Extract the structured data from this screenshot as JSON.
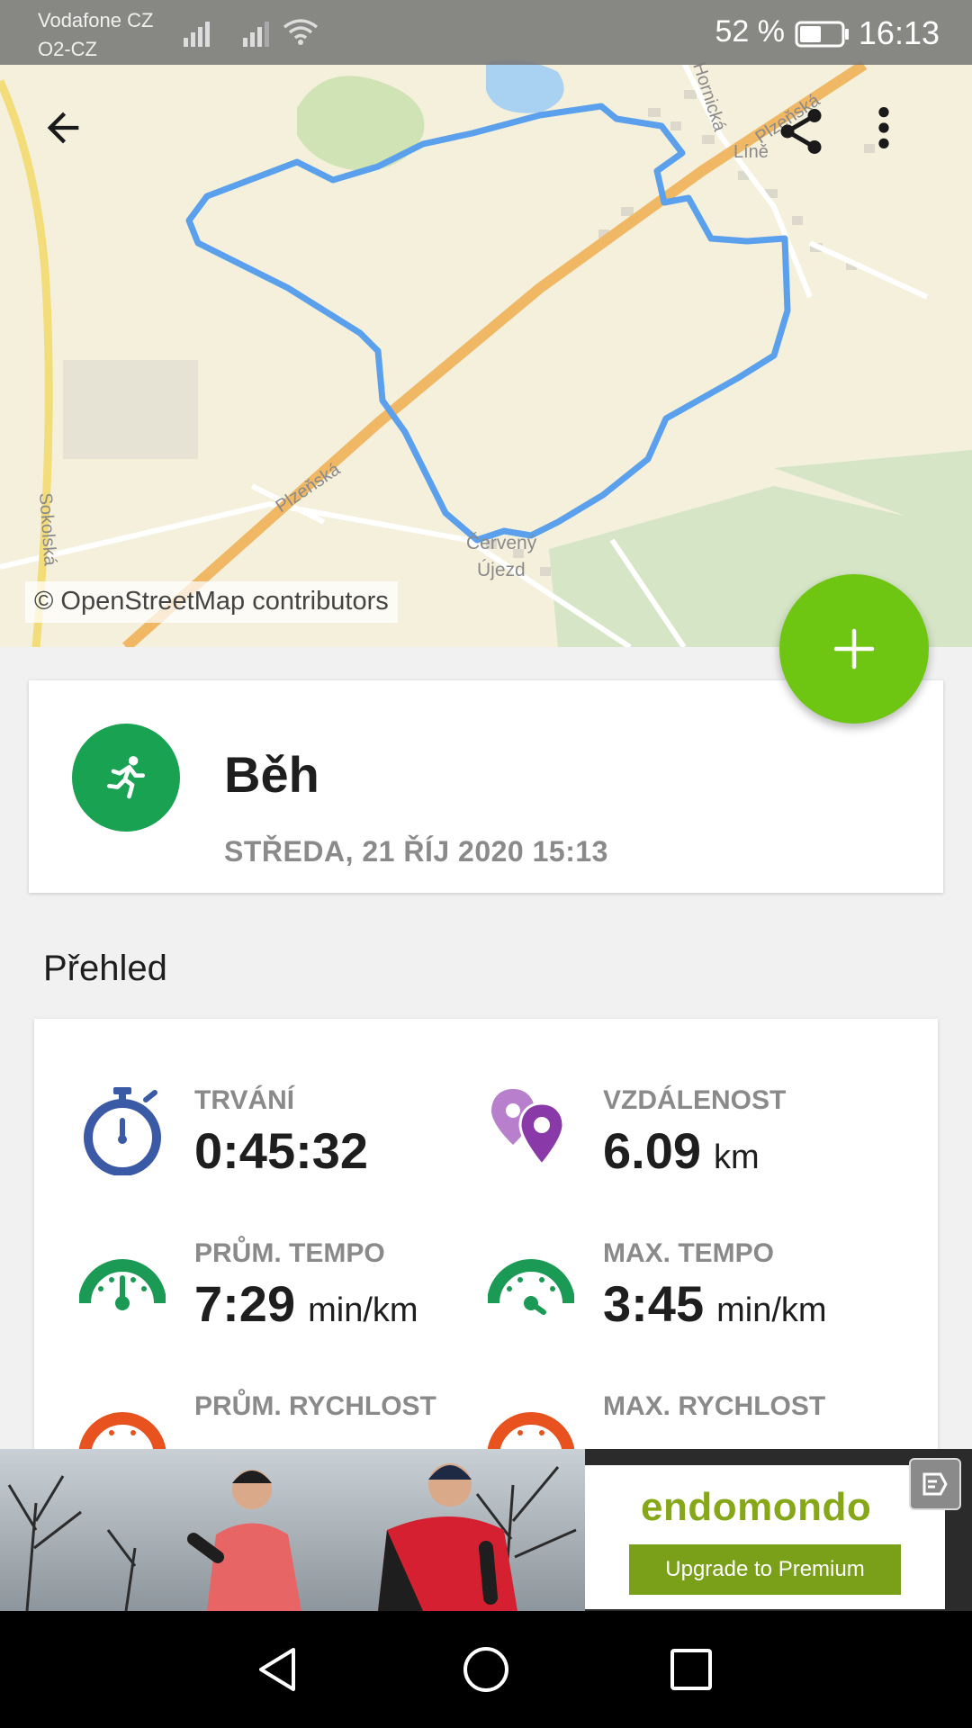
{
  "status_bar": {
    "carrier_line1": "Vodafone CZ",
    "carrier_line2": "O2-CZ",
    "battery_percent": "52 %",
    "battery_level": 0.52,
    "time": "16:13"
  },
  "map": {
    "labels": {
      "hornicka": "Hornická",
      "plzenska_top": "Plzeňská",
      "line": "Líně",
      "plzenska_mid": "Plzeňská",
      "sokolska": "Sokolská",
      "cerveny": "Červený",
      "ujezd": "Újezd"
    },
    "attribution": "© OpenStreetMap contributors",
    "route_color": "#5aa0ec"
  },
  "toolbar": {
    "back_icon": "arrow-back-icon",
    "share_icon": "share-icon",
    "more_icon": "more-vert-icon"
  },
  "fab": {
    "icon": "plus-icon",
    "color": "#6ec613"
  },
  "activity": {
    "icon": "running-icon",
    "name": "Běh",
    "date": "STŘEDA, 21 ŘÍJ 2020 15:13",
    "color": "#1aa253"
  },
  "overview": {
    "title": "Přehled",
    "stats": [
      {
        "label": "TRVÁNÍ",
        "value": "0:45:32",
        "unit": "",
        "icon": "stopwatch-icon",
        "color": "#3b5aa6"
      },
      {
        "label": "VZDÁLENOST",
        "value": "6.09",
        "unit": "km",
        "icon": "location-pins-icon",
        "color": "#8a3aa8"
      },
      {
        "label": "PRŮM. TEMPO",
        "value": "7:29",
        "unit": "min/km",
        "icon": "speedometer-icon",
        "color": "#1a9a55"
      },
      {
        "label": "MAX. TEMPO",
        "value": "3:45",
        "unit": "min/km",
        "icon": "speedometer-icon",
        "color": "#1a9a55"
      },
      {
        "label": "PRŮM. RYCHLOST",
        "value": "",
        "unit": "",
        "icon": "speedometer-icon",
        "color": "#e8521e"
      },
      {
        "label": "MAX. RYCHLOST",
        "value": "",
        "unit": "",
        "icon": "speedometer-icon",
        "color": "#e8521e"
      }
    ]
  },
  "ad": {
    "brand": "endomondo",
    "cta": "Upgrade to Premium",
    "badge_icon": "ad-choices-icon",
    "brand_color": "#86a818"
  },
  "nav_bar": {
    "back_icon": "nav-back-icon",
    "home_icon": "nav-home-icon",
    "recents_icon": "nav-recents-icon"
  }
}
